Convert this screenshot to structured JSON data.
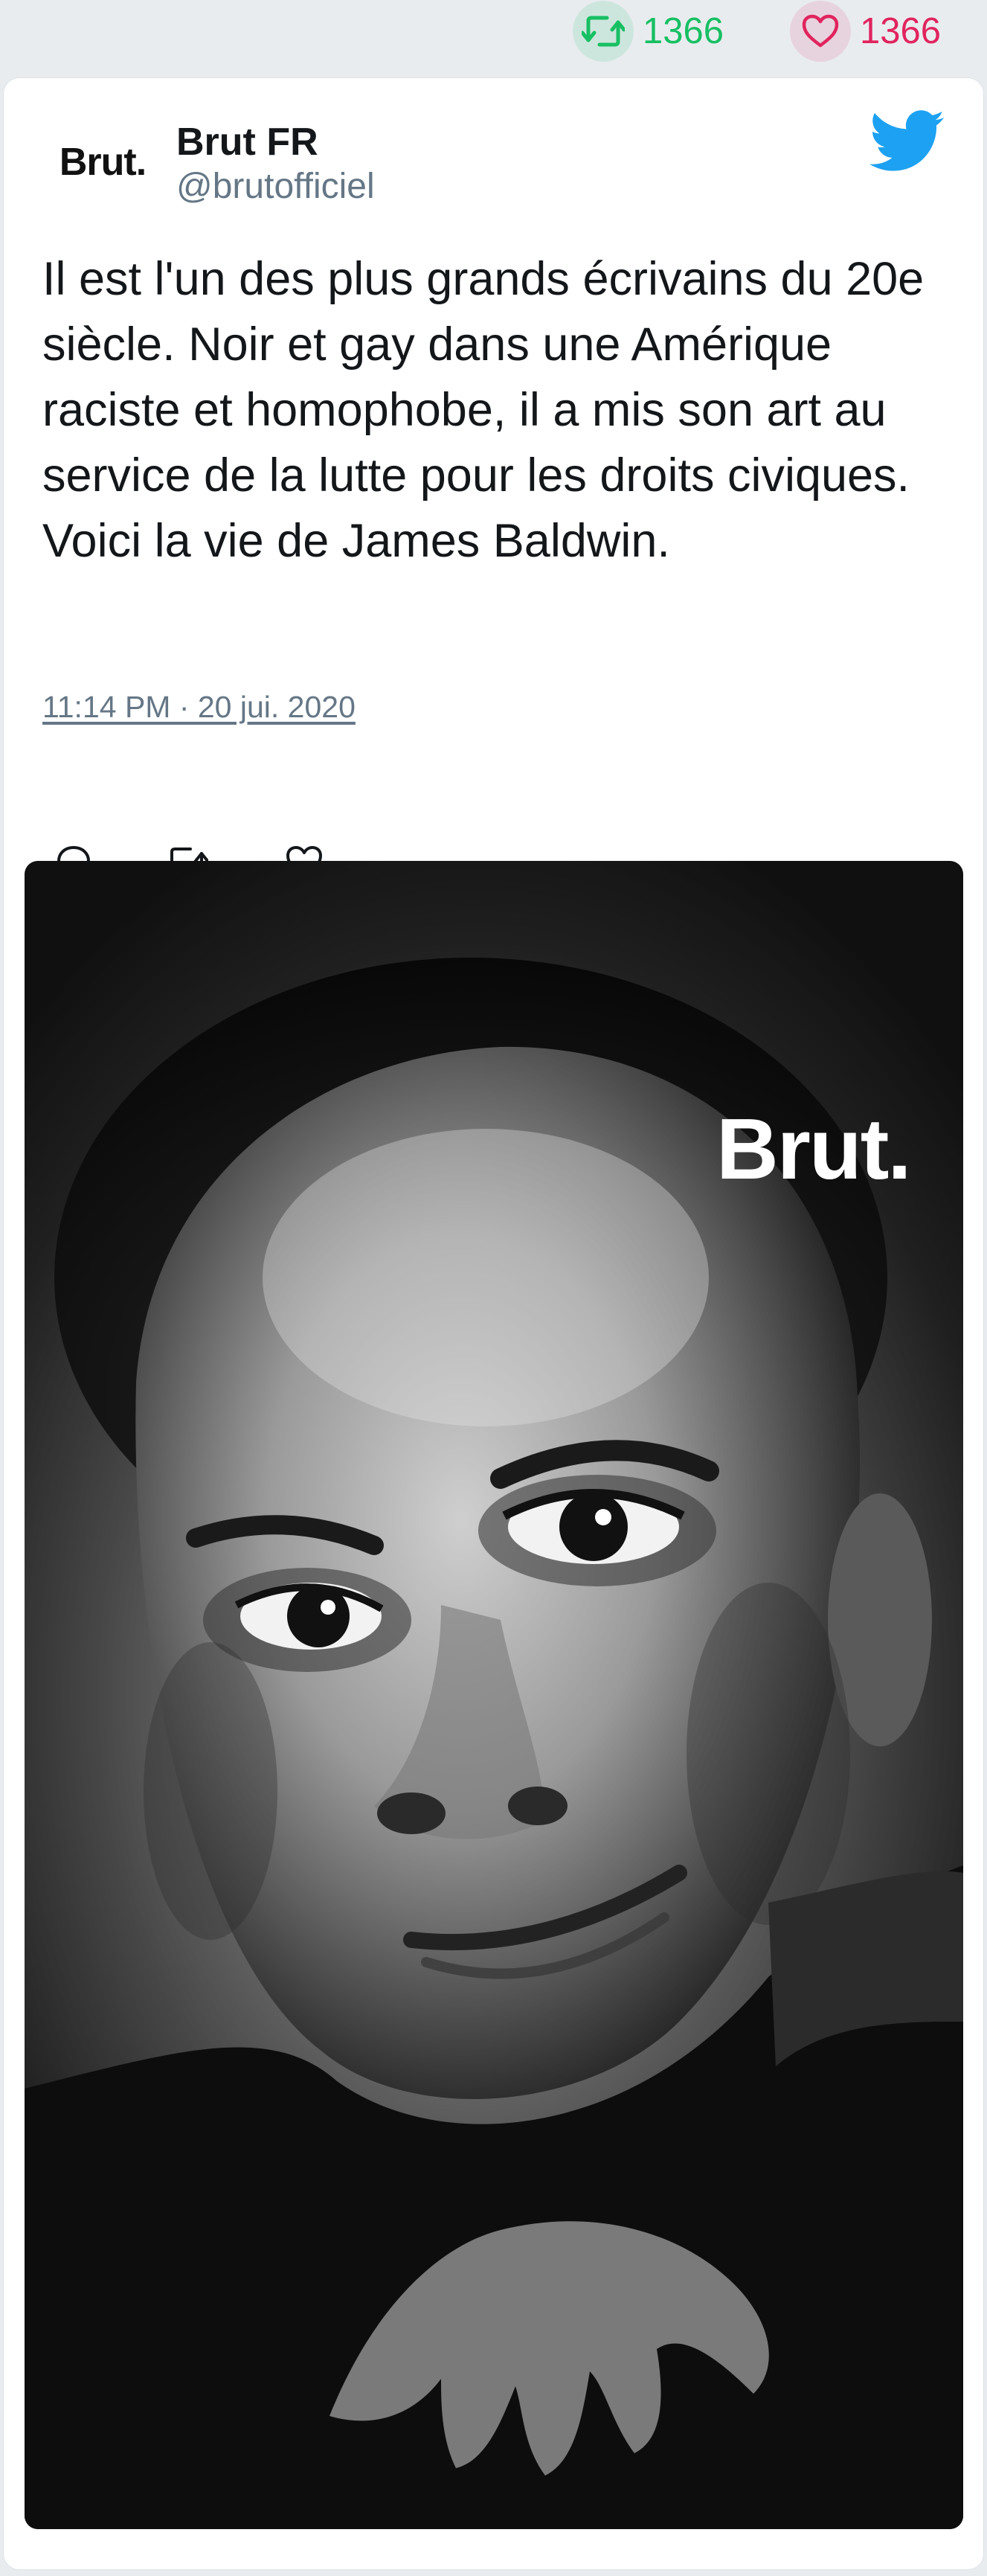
{
  "stats": {
    "retweet_count": "1366",
    "like_count": "1366",
    "retweet_icon": "retweet-icon",
    "like_icon": "heart-icon",
    "retweet_color": "#17bf63",
    "like_color": "#e0245e"
  },
  "tweet": {
    "avatar_text": "Brut.",
    "display_name": "Brut FR",
    "handle": "@brutofficiel",
    "text": "Il est l'un des plus grands écrivains du 20e siècle. Noir et gay dans une Amérique raciste et homophobe, il a mis son art au service de la lutte pour les droits civiques. Voici la vie de James Baldwin.",
    "timestamp": "11:14 PM · 20 jui. 2020",
    "brand_icon": "twitter-bird-icon",
    "brand_color": "#1da1f2"
  },
  "actions": [
    {
      "icon": "reply-icon"
    },
    {
      "icon": "retweet-icon"
    },
    {
      "icon": "like-icon"
    }
  ],
  "media": {
    "type": "black-and-white portrait photo",
    "watermark": "Brut."
  }
}
